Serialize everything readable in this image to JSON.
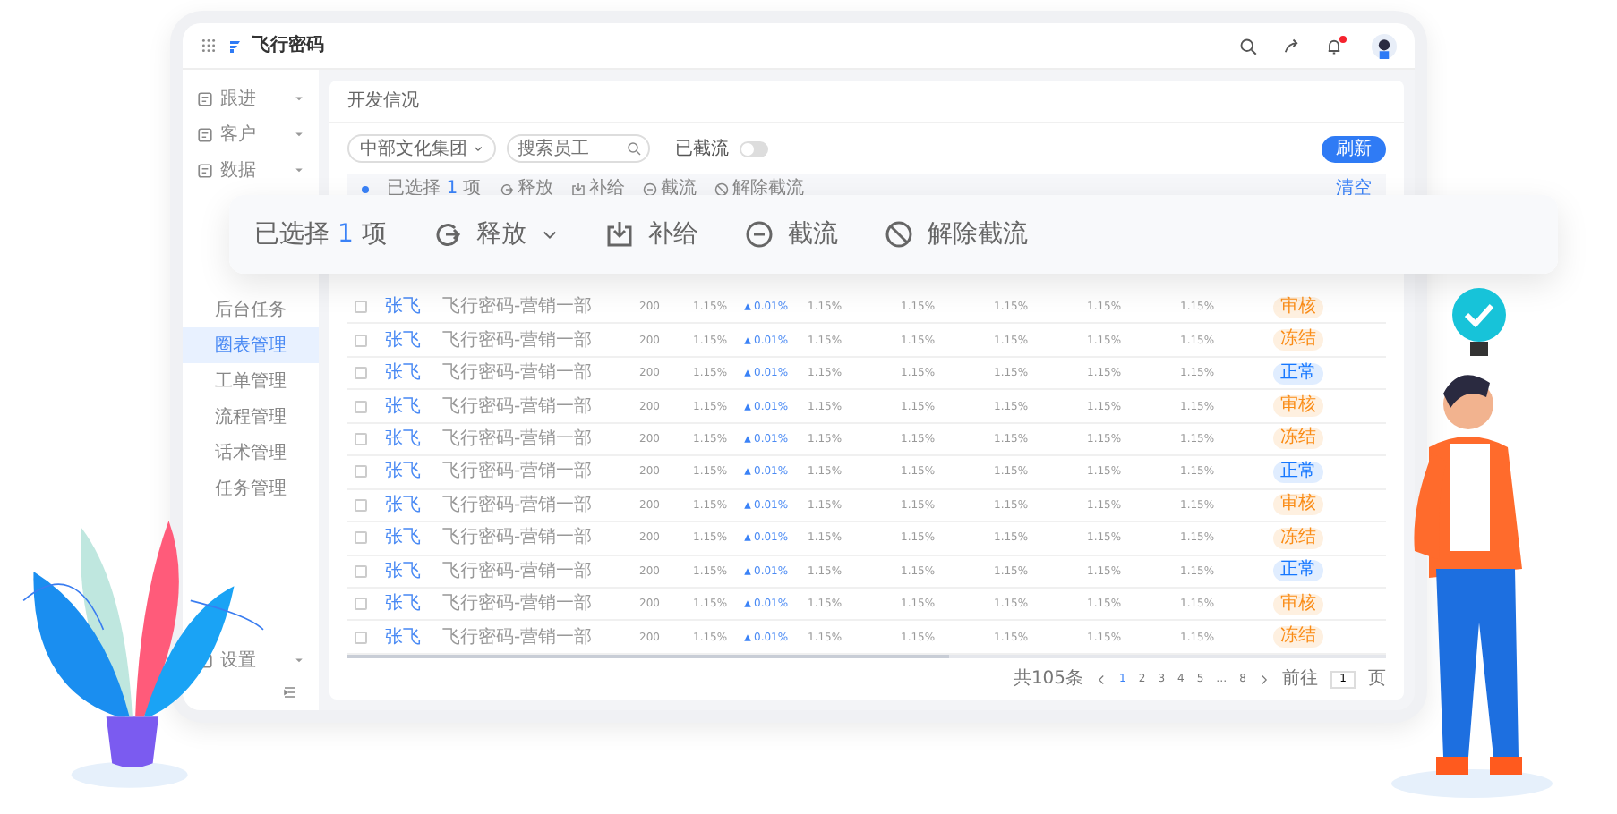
{
  "top_bar": {
    "logo": "飞行密码",
    "notifications_unread": true
  },
  "sidebar": {
    "items": [
      {
        "kind": "group",
        "label": "跟进",
        "selected": false
      },
      {
        "kind": "group",
        "label": "客户",
        "selected": false
      },
      {
        "kind": "group",
        "label": "数据",
        "selected": false
      },
      {
        "kind": "page",
        "label": "后台任务",
        "selected": false
      },
      {
        "kind": "page",
        "label": "圈表管理",
        "selected": true
      },
      {
        "kind": "page",
        "label": "工单管理",
        "selected": false
      },
      {
        "kind": "page",
        "label": "流程管理",
        "selected": false
      },
      {
        "kind": "page",
        "label": "话术管理",
        "selected": false
      },
      {
        "kind": "page",
        "label": "任务管理",
        "selected": false
      },
      {
        "kind": "group",
        "label": "设置",
        "selected": false
      }
    ]
  },
  "page": {
    "title": "开发信况",
    "filters": {
      "company": "中部文化集团",
      "search": {
        "placeholder": "搜索员工"
      },
      "toggle": {
        "label": "已截流",
        "on": false
      },
      "button": "刷新"
    },
    "selection_bar": {
      "count_prefix": "已选择",
      "count": "1",
      "count_suffix": "项",
      "actions": [
        "释放",
        "补给",
        "截流",
        "解除截流"
      ],
      "clear": "清空"
    },
    "table": {
      "rows": [
        {
          "checked": false,
          "name": "张飞",
          "team": "飞行密码-营销一部",
          "amount": "200",
          "rate": "1.15%",
          "change": "0.01%",
          "c1": "1.15%",
          "c2": "1.15%",
          "c3": "1.15%",
          "c4": "1.15%",
          "c5": "1.15%",
          "status": "审核",
          "color": "#fa8c16"
        },
        {
          "checked": false,
          "name": "张飞",
          "team": "飞行密码-营销一部",
          "amount": "200",
          "rate": "1.15%",
          "change": "0.01%",
          "c1": "1.15%",
          "c2": "1.15%",
          "c3": "1.15%",
          "c4": "1.15%",
          "c5": "1.15%",
          "status": "冻结",
          "color": "#fa8c16"
        },
        {
          "checked": false,
          "name": "张飞",
          "team": "飞行密码-营销一部",
          "amount": "200",
          "rate": "1.15%",
          "change": "0.01%",
          "c1": "1.15%",
          "c2": "1.15%",
          "c3": "1.15%",
          "c4": "1.15%",
          "c5": "1.15%",
          "status": "正常",
          "color": "#1677ff"
        },
        {
          "checked": false,
          "name": "张飞",
          "team": "飞行密码-营销一部",
          "amount": "200",
          "rate": "1.15%",
          "change": "0.01%",
          "c1": "1.15%",
          "c2": "1.15%",
          "c3": "1.15%",
          "c4": "1.15%",
          "c5": "1.15%",
          "status": "审核",
          "color": "#fa8c16"
        },
        {
          "checked": false,
          "name": "张飞",
          "team": "飞行密码-营销一部",
          "amount": "200",
          "rate": "1.15%",
          "change": "0.01%",
          "c1": "1.15%",
          "c2": "1.15%",
          "c3": "1.15%",
          "c4": "1.15%",
          "c5": "1.15%",
          "status": "冻结",
          "color": "#fa8c16"
        },
        {
          "checked": false,
          "name": "张飞",
          "team": "飞行密码-营销一部",
          "amount": "200",
          "rate": "1.15%",
          "change": "0.01%",
          "c1": "1.15%",
          "c2": "1.15%",
          "c3": "1.15%",
          "c4": "1.15%",
          "c5": "1.15%",
          "status": "正常",
          "color": "#1677ff"
        },
        {
          "checked": false,
          "name": "张飞",
          "team": "飞行密码-营销一部",
          "amount": "200",
          "rate": "1.15%",
          "change": "0.01%",
          "c1": "1.15%",
          "c2": "1.15%",
          "c3": "1.15%",
          "c4": "1.15%",
          "c5": "1.15%",
          "status": "审核",
          "color": "#fa8c16"
        },
        {
          "checked": false,
          "name": "张飞",
          "team": "飞行密码-营销一部",
          "amount": "200",
          "rate": "1.15%",
          "change": "0.01%",
          "c1": "1.15%",
          "c2": "1.15%",
          "c3": "1.15%",
          "c4": "1.15%",
          "c5": "1.15%",
          "status": "冻结",
          "color": "#fa8c16"
        },
        {
          "checked": false,
          "name": "张飞",
          "team": "飞行密码-营销一部",
          "amount": "200",
          "rate": "1.15%",
          "change": "0.01%",
          "c1": "1.15%",
          "c2": "1.15%",
          "c3": "1.15%",
          "c4": "1.15%",
          "c5": "1.15%",
          "status": "正常",
          "color": "#1677ff"
        },
        {
          "checked": false,
          "name": "张飞",
          "team": "飞行密码-营销一部",
          "amount": "200",
          "rate": "1.15%",
          "change": "0.01%",
          "c1": "1.15%",
          "c2": "1.15%",
          "c3": "1.15%",
          "c4": "1.15%",
          "c5": "1.15%",
          "status": "审核",
          "color": "#fa8c16"
        },
        {
          "checked": false,
          "name": "张飞",
          "team": "飞行密码-营销一部",
          "amount": "200",
          "rate": "1.15%",
          "change": "0.01%",
          "c1": "1.15%",
          "c2": "1.15%",
          "c3": "1.15%",
          "c4": "1.15%",
          "c5": "1.15%",
          "status": "冻结",
          "color": "#fa8c16"
        }
      ]
    },
    "pagination": {
      "total": "共105条",
      "pages": [
        {
          "label": "1",
          "selected": true
        },
        {
          "label": "2",
          "selected": false
        },
        {
          "label": "3",
          "selected": false
        },
        {
          "label": "4",
          "selected": false
        },
        {
          "label": "5",
          "selected": false
        },
        {
          "label": "…",
          "selected": false
        },
        {
          "label": "8",
          "selected": false
        }
      ],
      "goto_prefix": "前往",
      "goto_value": "1",
      "goto_suffix": "页"
    }
  },
  "floating_toolbar": {
    "count_prefix": "已选择",
    "count": "1",
    "count_suffix": "项",
    "actions": [
      "释放",
      "补给",
      "截流",
      "解除截流"
    ]
  }
}
